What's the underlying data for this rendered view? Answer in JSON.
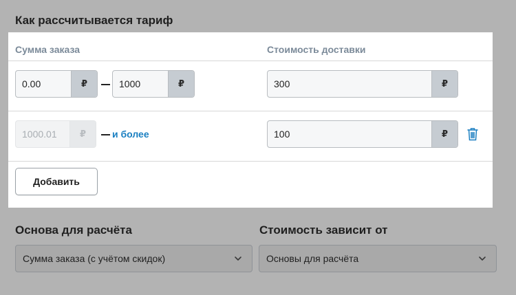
{
  "section": {
    "title": "Как рассчитывается тариф"
  },
  "columns": {
    "order_sum": "Сумма заказа",
    "delivery_cost": "Стоимость доставки"
  },
  "currency_symbol": "₽",
  "tiers": [
    {
      "from": "0.00",
      "to": "1000",
      "cost": "300"
    },
    {
      "from": "1000.01",
      "to_text": "и более",
      "cost": "100"
    }
  ],
  "add_button": "Добавить",
  "basis": {
    "label": "Основа для расчёта",
    "selected": "Сумма заказа (с учётом скидок)"
  },
  "depends": {
    "label": "Стоимость зависит от",
    "selected": "Основы для расчёта"
  },
  "colors": {
    "link": "#1a7fc1",
    "overlay": "#b3b3b3",
    "panel": "#ffffff"
  },
  "icons": {
    "delete": "trash-icon",
    "dropdown": "chevron-down-icon"
  }
}
